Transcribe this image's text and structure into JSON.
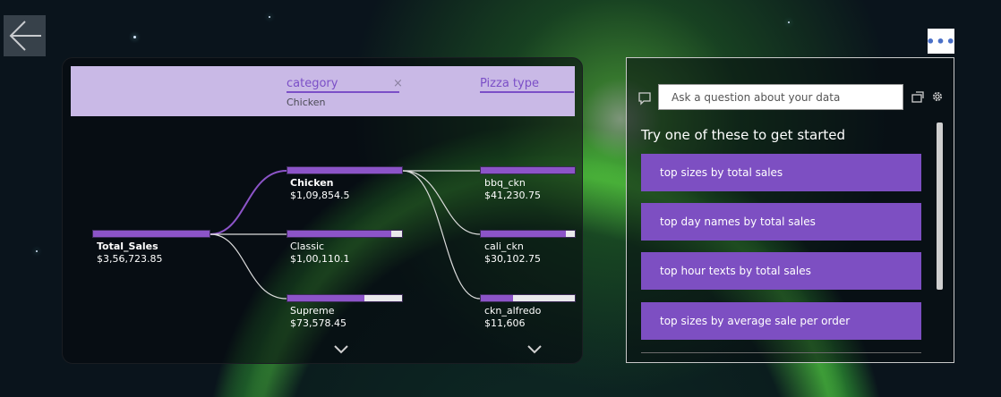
{
  "back": {
    "icon": "arrow-left-icon"
  },
  "decomp": {
    "levels": [
      {
        "title": "category",
        "selected": "Chicken",
        "close": "×"
      },
      {
        "title": "Pizza type"
      }
    ],
    "root": {
      "label": "Total_Sales",
      "value": "$3,56,723.85",
      "fill": 1.0
    },
    "categories": [
      {
        "label": "Chicken",
        "value": "$1,09,854.5",
        "fill": 1.0,
        "selected": true
      },
      {
        "label": "Classic",
        "value": "$1,00,110.1",
        "fill": 0.91
      },
      {
        "label": "Supreme",
        "value": "$73,578.45",
        "fill": 0.67
      }
    ],
    "types": [
      {
        "label": "bbq_ckn",
        "value": "$41,230.75",
        "fill": 1.0
      },
      {
        "label": "cali_ckn",
        "value": "$30,102.75",
        "fill": 0.9
      },
      {
        "label": "ckn_alfredo",
        "value": "$11,606",
        "fill": 0.34
      }
    ]
  },
  "qa": {
    "placeholder": "Ask a question about your data",
    "heading": "Try one of these to get started",
    "suggestions": [
      "top sizes by total sales",
      "top day names by total sales",
      "top hour texts by total sales",
      "top sizes by average sale per order"
    ],
    "more_label": "•••"
  }
}
